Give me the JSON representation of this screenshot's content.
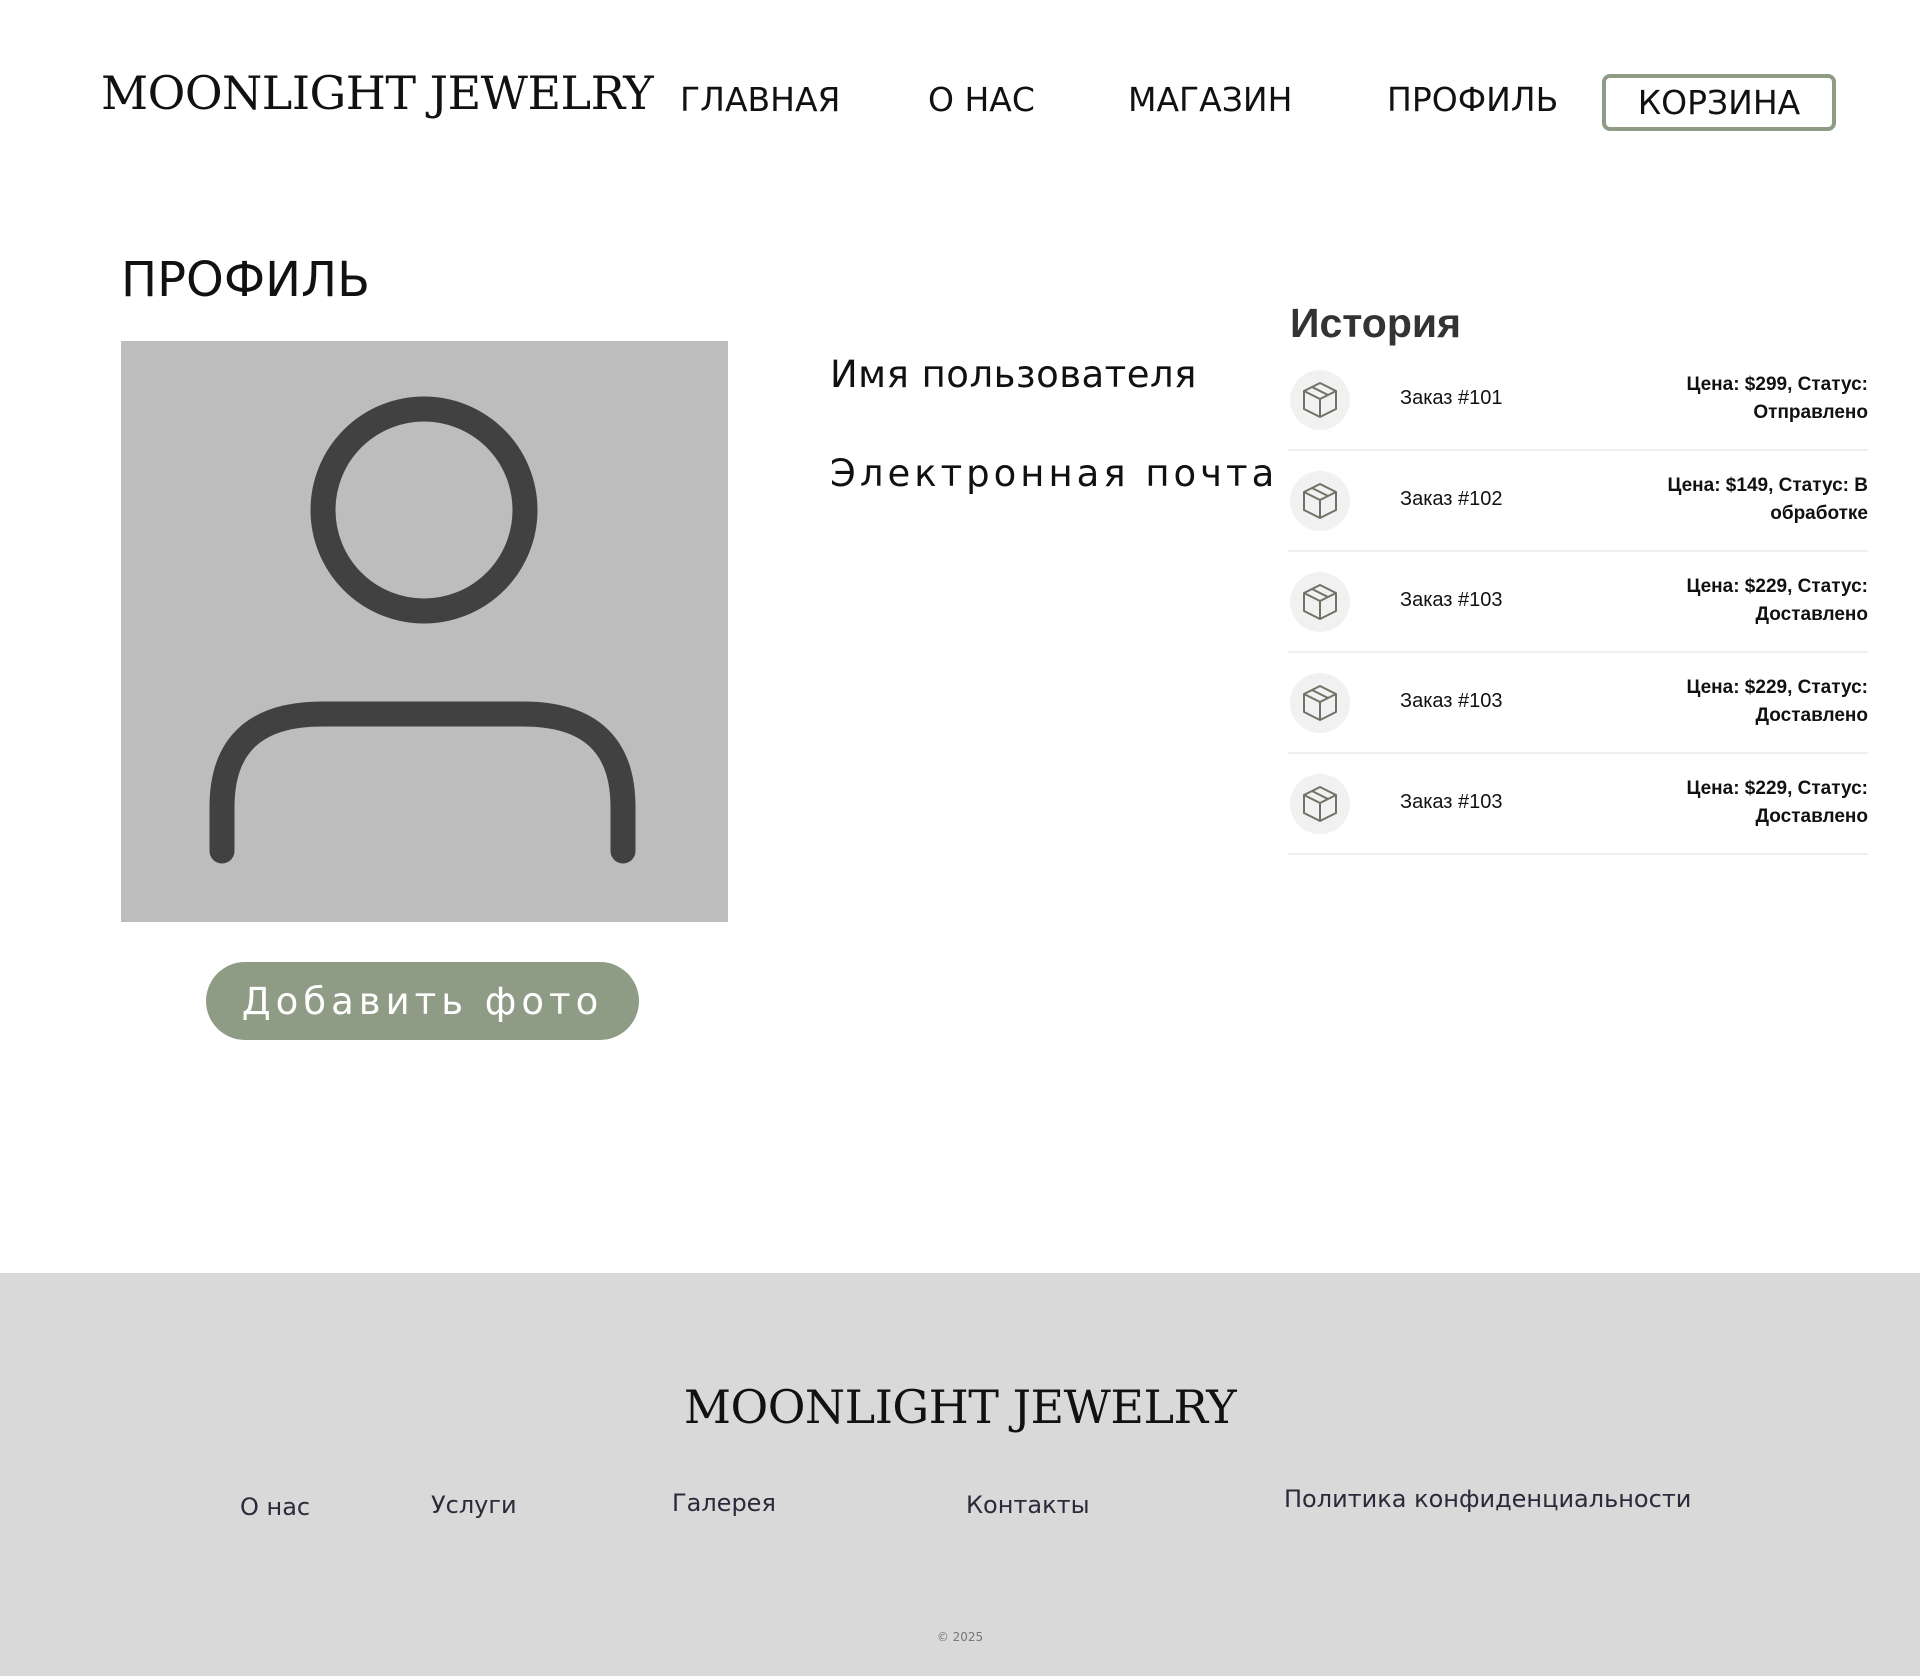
{
  "header": {
    "logo": "MOONLIGHT JEWELRY",
    "nav": [
      "ГЛАВНАЯ",
      "О НАС",
      "МАГАЗИН",
      "ПРОФИЛЬ"
    ],
    "cart_label": "КОРЗИНА"
  },
  "profile": {
    "title": "ПРОФИЛЬ",
    "avatar_icon": "user-icon",
    "add_photo_label": "Добавить фото",
    "username_label": "Имя пользователя",
    "email_label": "Электронная почта"
  },
  "history": {
    "title": "История",
    "order_icon": "box-icon",
    "orders": [
      {
        "name": "Заказ #101",
        "info": "Цена: $299, Статус: Отправлено"
      },
      {
        "name": "Заказ #102",
        "info": "Цена: $149, Статус: В обработке"
      },
      {
        "name": "Заказ #103",
        "info": "Цена: $229, Статус: Доставлено"
      },
      {
        "name": "Заказ #103",
        "info": "Цена: $229, Статус: Доставлено"
      },
      {
        "name": "Заказ #103",
        "info": "Цена: $229, Статус: Доставлено"
      }
    ]
  },
  "footer": {
    "logo": "MOONLIGHT JEWELRY",
    "links": [
      "О нас",
      "Услуги",
      "Галерея",
      "Контакты",
      "Политика конфиденциальности"
    ],
    "copyright": "© 2025"
  },
  "colors": {
    "accent": "#8e9b85",
    "avatar_bg": "#bdbdbd",
    "avatar_icon": "#414141",
    "footer_bg": "#d9d9d9"
  }
}
